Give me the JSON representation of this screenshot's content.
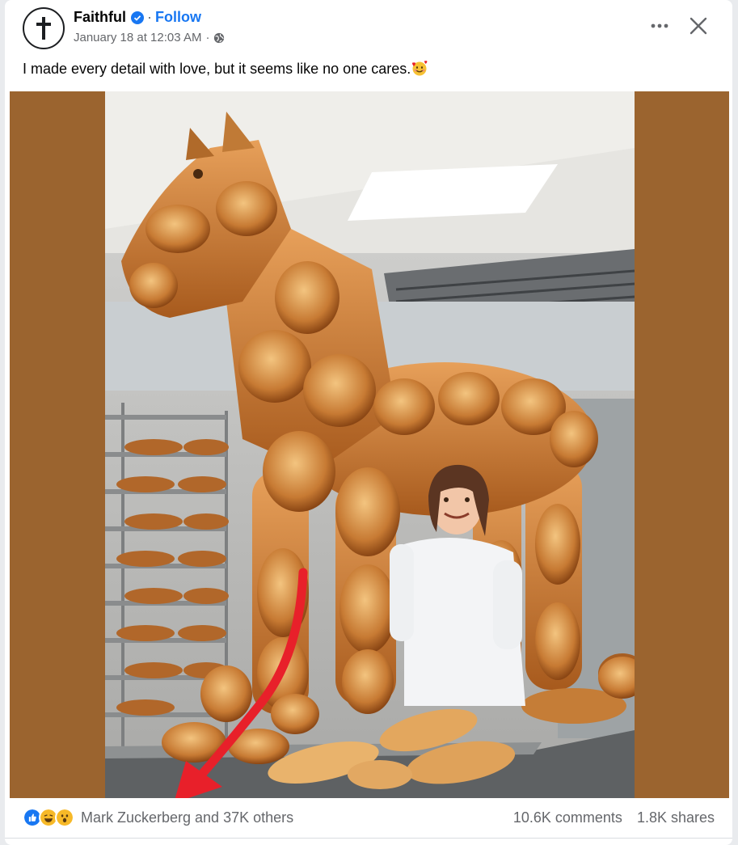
{
  "post": {
    "author": "Faithful",
    "follow_label": "Follow",
    "separator": "·",
    "timestamp": "January 18 at 12:03 AM",
    "meta_separator": "·",
    "caption": "I made every detail with love, but it seems like no one cares.",
    "caption_emoji": "smiling-face-with-hearts"
  },
  "header_icons": {
    "avatar": "cross-icon",
    "verified": "verified-badge-icon",
    "audience": "globe-icon",
    "more": "more-options-icon",
    "close": "close-icon"
  },
  "footer": {
    "reaction_icons": [
      "like-icon",
      "haha-icon",
      "wow-icon"
    ],
    "reaction_text": "Mark Zuckerberg and 37K others",
    "comments": "10.6K comments",
    "shares": "1.8K shares"
  },
  "colors": {
    "accent": "#1877f2",
    "secondary_text": "#65676b",
    "media_background": "#9b642f",
    "arrow": "#e8202a"
  }
}
